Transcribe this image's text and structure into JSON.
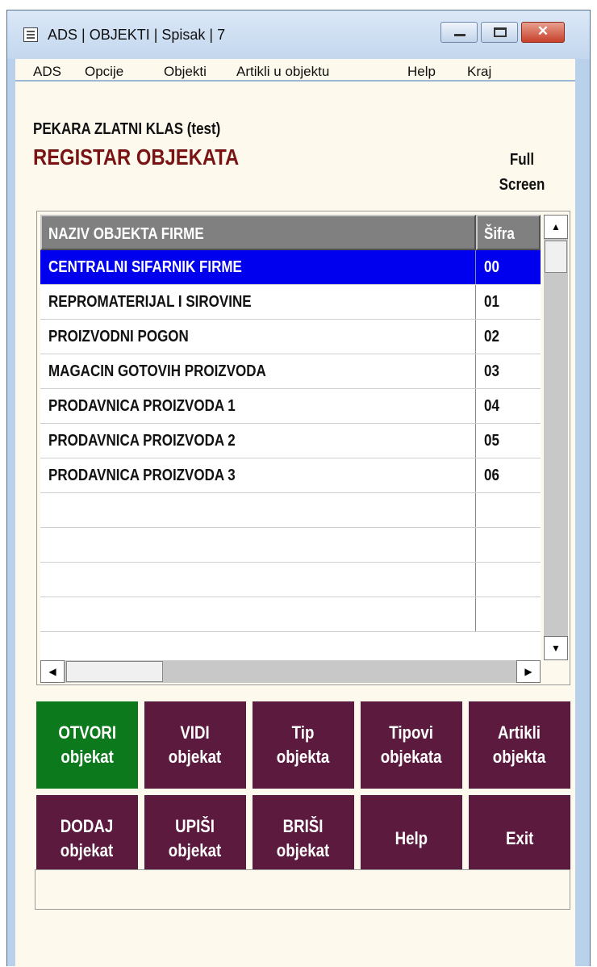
{
  "window": {
    "title": "ADS | OBJEKTI | Spisak | 7"
  },
  "menu": [
    "ADS",
    "Opcije",
    "Objekti",
    "Artikli u objektu",
    "Help",
    "Kraj"
  ],
  "header": {
    "company": "PEKARA ZLATNI KLAS (test)",
    "register": "REGISTAR OBJEKATA",
    "full_screen_line1": "Full",
    "full_screen_line2": "Screen"
  },
  "table": {
    "columns": [
      "NAZIV OBJEKTA FIRME",
      "Šifra"
    ],
    "rows": [
      [
        "CENTRALNI SIFARNIK FIRME",
        "00"
      ],
      [
        "REPROMATERIJAL I SIROVINE",
        "01"
      ],
      [
        "PROIZVODNI POGON",
        "02"
      ],
      [
        "MAGACIN GOTOVIH PROIZVODA",
        "03"
      ],
      [
        "PRODAVNICA PROIZVODA 1",
        "04"
      ],
      [
        "PRODAVNICA PROIZVODA 2",
        "05"
      ],
      [
        "PRODAVNICA PROIZVODA 3",
        "06"
      ]
    ],
    "selected_row": 0
  },
  "buttons": {
    "otvori": "OTVORI\nobjekat",
    "vidi": "VIDI\nobjekat",
    "tip": "Tip\nobjekta",
    "tipovi": "Tipovi\nobjekata",
    "artikli": "Artikli\nobjekta",
    "dodaj": "DODAJ\nobjekat",
    "upisi": "UPIŠI\nobjekat",
    "brisi": "BRIŠI\nobjekat",
    "help": "Help",
    "exit": "Exit"
  },
  "colors": {
    "button": "#5b1a3e",
    "button_active": "#0c7a1c",
    "selection": "#0000ee",
    "title_red": "#7a1414",
    "background": "#fdf9ec"
  }
}
